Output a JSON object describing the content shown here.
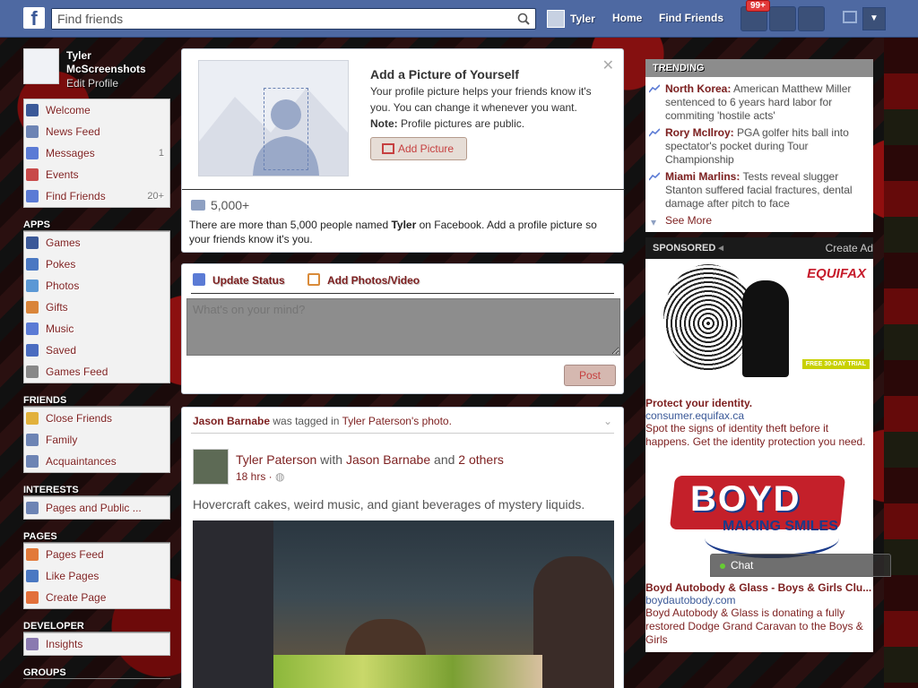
{
  "topbar": {
    "logo": "f",
    "search_placeholder": "Find friends",
    "user_name": "Tyler",
    "home": "Home",
    "find_friends": "Find Friends",
    "notif_badge": "99+"
  },
  "profile": {
    "name": "Tyler McScreenshots",
    "edit": "Edit Profile"
  },
  "nav": {
    "main": [
      {
        "label": "Welcome",
        "icon": "facebook-icon"
      },
      {
        "label": "News Feed",
        "icon": "news-feed-icon"
      },
      {
        "label": "Messages",
        "icon": "messages-icon",
        "count": "1"
      },
      {
        "label": "Events",
        "icon": "calendar-icon"
      },
      {
        "label": "Find Friends",
        "icon": "find-friends-icon",
        "count": "20+"
      }
    ],
    "apps_head": "APPS",
    "apps": [
      {
        "label": "Games",
        "icon": "games-icon"
      },
      {
        "label": "Pokes",
        "icon": "pokes-icon"
      },
      {
        "label": "Photos",
        "icon": "photos-icon"
      },
      {
        "label": "Gifts",
        "icon": "gifts-icon"
      },
      {
        "label": "Music",
        "icon": "music-icon"
      },
      {
        "label": "Saved",
        "icon": "saved-icon"
      },
      {
        "label": "Games Feed",
        "icon": "games-feed-icon"
      }
    ],
    "friends_head": "FRIENDS",
    "friends": [
      {
        "label": "Close Friends",
        "icon": "star-icon"
      },
      {
        "label": "Family",
        "icon": "family-icon"
      },
      {
        "label": "Acquaintances",
        "icon": "acquaintances-icon"
      }
    ],
    "interests_head": "INTERESTS",
    "interests": [
      {
        "label": "Pages and Public ...",
        "icon": "rss-icon"
      }
    ],
    "pages_head": "PAGES",
    "pages": [
      {
        "label": "Pages Feed",
        "icon": "megaphone-icon"
      },
      {
        "label": "Like Pages",
        "icon": "thumbs-up-icon"
      },
      {
        "label": "Create Page",
        "icon": "plus-icon"
      }
    ],
    "developer_head": "DEVELOPER",
    "developer": [
      {
        "label": "Insights",
        "icon": "insights-icon"
      }
    ],
    "groups_head": "GROUPS"
  },
  "profile_prompt": {
    "title": "Add a Picture of Yourself",
    "text": "Your profile picture helps your friends know it's you. You can change it whenever you want.",
    "note_label": "Note:",
    "note_text": "Profile pictures are public.",
    "button": "Add Picture",
    "count": "5,000+",
    "info_pre": "There are more than 5,000 people named ",
    "info_name": "Tyler",
    "info_post": " on Facebook. Add a profile picture so your friends know it's you."
  },
  "composer": {
    "tab_status": "Update Status",
    "tab_photo": "Add Photos/Video",
    "placeholder": "What's on your mind?",
    "post": "Post"
  },
  "story": {
    "head_person": "Jason Barnabe",
    "head_mid": "was tagged in",
    "head_photo": "Tyler Paterson's photo.",
    "author": "Tyler Paterson",
    "with": "with",
    "with_person": "Jason Barnabe",
    "and": "and",
    "others": "2 others",
    "time": "18 hrs · ",
    "text": "Hovercraft cakes, weird music, and giant beverages of mystery liquids."
  },
  "trending": {
    "head": "TRENDING",
    "items": [
      {
        "topic": "North Korea:",
        "text": "American Matthew Miller sentenced to 6 years hard labor for commiting 'hostile acts'"
      },
      {
        "topic": "Rory McIlroy:",
        "text": "PGA golfer hits ball into spectator's pocket during Tour Championship"
      },
      {
        "topic": "Miami Marlins:",
        "text": "Tests reveal slugger Stanton suffered facial fractures, dental damage after pitch to face"
      }
    ],
    "see_more": "See More"
  },
  "sponsored": {
    "head": "SPONSORED",
    "create": "Create Ad",
    "ad1": {
      "logo": "EQUIFAX",
      "trial": "FREE 30-DAY TRIAL",
      "title": "Protect your identity.",
      "url": "consumer.equifax.ca",
      "text": "Spot the signs of identity theft before it happens. Get the identity protection you need."
    },
    "ad2": {
      "logo": "BOYD",
      "sub": "MAKING SMILES",
      "title": "Boyd Autobody & Glass - Boys & Girls Clu...",
      "url": "boydautobody.com",
      "text": "Boyd Autobody & Glass is donating a fully restored Dodge Grand Caravan to the Boys & Girls"
    }
  },
  "chat": {
    "label": "Chat"
  }
}
